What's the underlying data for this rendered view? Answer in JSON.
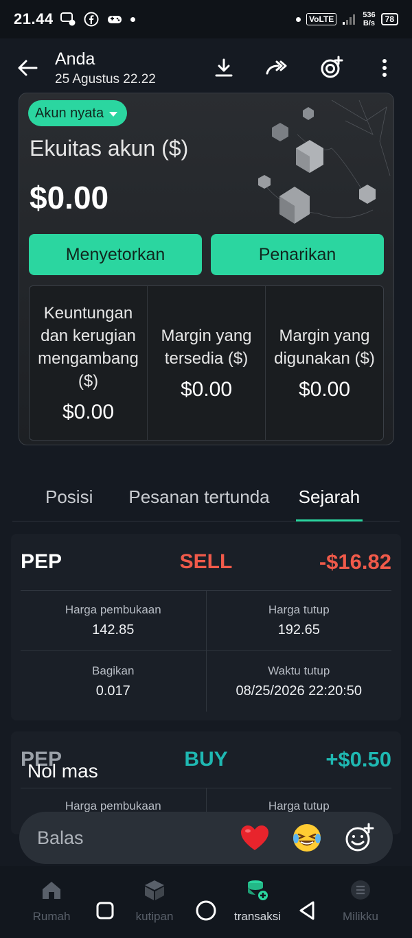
{
  "status_bar": {
    "time": "21.44",
    "network": "VoLTE",
    "speed_top": "536",
    "speed_bottom": "B/s",
    "battery": "78"
  },
  "header": {
    "title": "Anda",
    "subtitle": "25 Agustus 22.22"
  },
  "account": {
    "badge": "Akun nyata",
    "equity_label": "Ekuitas akun ($)",
    "equity_value": "$0.00",
    "deposit_label": "Menyetorkan",
    "withdraw_label": "Penarikan",
    "stats": [
      {
        "label": "Keuntungan dan kerugian mengambang ($)",
        "value": "$0.00"
      },
      {
        "label": "Margin yang tersedia ($)",
        "value": "$0.00"
      },
      {
        "label": "Margin yang digunakan ($)",
        "value": "$0.00"
      }
    ]
  },
  "tabs": [
    "Posisi",
    "Pesanan tertunda",
    "Sejarah"
  ],
  "active_tab": "Sejarah",
  "history": [
    {
      "symbol": "PEP",
      "side": "SELL",
      "pnl": "-$16.82",
      "open_label": "Harga pembukaan",
      "open_value": "142.85",
      "close_label": "Harga tutup",
      "close_value": "192.65",
      "shares_label": "Bagikan",
      "shares_value": "0.017",
      "time_label": "Waktu tutup",
      "time_value": "08/25/2026 22:20:50"
    },
    {
      "symbol": "PEP",
      "side": "BUY",
      "pnl": "+$0.50",
      "open_label": "Harga pembukaan",
      "close_label": "Harga tutup"
    }
  ],
  "overlay_text": "Nol mas",
  "reply": {
    "placeholder": "Balas"
  },
  "bottom_nav": [
    "Rumah",
    "kutipan",
    "transaksi",
    "Milikku"
  ],
  "colors": {
    "accent": "#2bd6a0",
    "sell": "#f05a4a",
    "buy": "#1fb8b2",
    "background": "#151a22"
  }
}
